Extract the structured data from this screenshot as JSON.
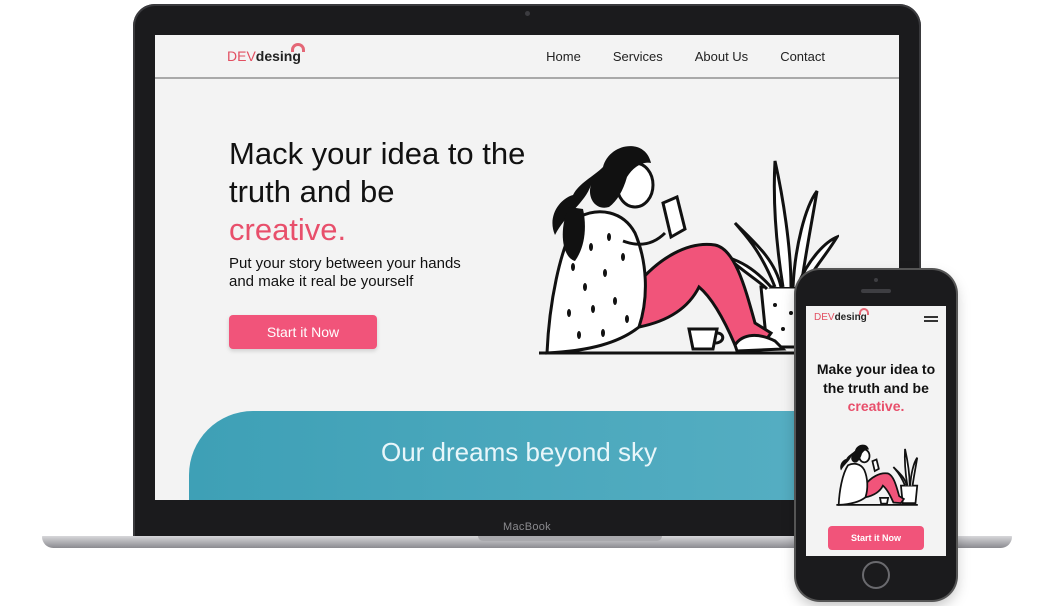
{
  "laptop": {
    "brand": "MacBook",
    "site": {
      "logo": {
        "dev": "DEV",
        "desing": "desing"
      },
      "nav": [
        "Home",
        "Services",
        "About Us",
        "Contact"
      ],
      "hero": {
        "title": "Mack your idea to the truth and be",
        "title_accent": "creative.",
        "subtitle": "Put your story between your hands and make it real be yourself",
        "cta": "Start it Now"
      },
      "section_title": "Our dreams beyond sky"
    }
  },
  "phone": {
    "site": {
      "logo": {
        "dev": "DEV",
        "desing": "desing"
      },
      "hero": {
        "title": "Make your idea to the truth and be",
        "title_accent": "creative.",
        "cta": "Start it Now"
      }
    }
  },
  "colors": {
    "accent": "#e84f6b",
    "button": "#f1547a",
    "teal": "#3ea0b6",
    "device": "#1b1b1d"
  }
}
